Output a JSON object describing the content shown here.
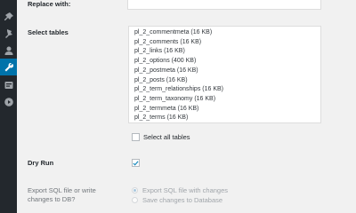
{
  "sidebar": {
    "icons": [
      "pin-icon",
      "thumbtack-icon",
      "users-icon",
      "tools-icon",
      "settings-icon",
      "play-icon"
    ],
    "active_index": 3
  },
  "form": {
    "replace_with": {
      "label": "Replace with:",
      "value": ""
    },
    "select_tables": {
      "label": "Select tables",
      "options": [
        "pl_2_commentmeta (16 KB)",
        "pl_2_comments (16 KB)",
        "pl_2_links (16 KB)",
        "pl_2_options (400 KB)",
        "pl_2_postmeta (16 KB)",
        "pl_2_posts (16 KB)",
        "pl_2_term_relationships (16 KB)",
        "pl_2_term_taxonomy (16 KB)",
        "pl_2_termmeta (16 KB)",
        "pl_2_terms (16 KB)"
      ],
      "select_all_label": "Select all tables",
      "select_all_checked": false
    },
    "dry_run": {
      "label": "Dry Run",
      "checked": true
    },
    "export": {
      "label_line1": "Export SQL file or write",
      "label_line2": "changes to DB?",
      "options": [
        {
          "label": "Export SQL file with changes",
          "selected": true
        },
        {
          "label": "Save changes to Database",
          "selected": false
        }
      ]
    }
  },
  "colors": {
    "sidebar_bg": "#23282d",
    "accent": "#0073aa",
    "checkmark": "#1e8cbe"
  }
}
